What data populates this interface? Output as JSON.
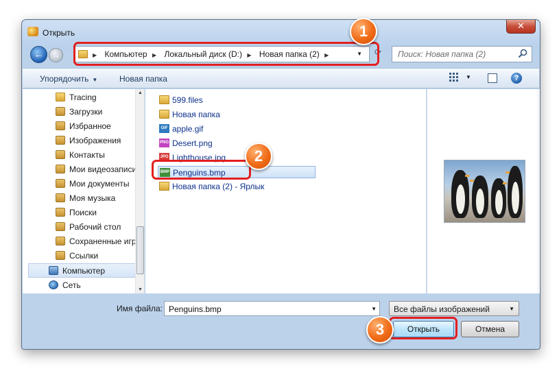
{
  "window": {
    "title": "Открыть",
    "close_label": "✕"
  },
  "address": {
    "crumbs": [
      "Компьютер",
      "Локальный диск (D:)",
      "Новая папка (2)"
    ]
  },
  "search": {
    "placeholder": "Поиск: Новая папка (2)"
  },
  "toolbar": {
    "organize": "Упорядочить",
    "new_folder": "Новая папка"
  },
  "nav": {
    "items": [
      {
        "label": "Tracing",
        "icon": "folder-icon"
      },
      {
        "label": "Загрузки",
        "icon": "downloads-icon"
      },
      {
        "label": "Избранное",
        "icon": "favorites-icon"
      },
      {
        "label": "Изображения",
        "icon": "pictures-icon"
      },
      {
        "label": "Контакты",
        "icon": "contacts-icon"
      },
      {
        "label": "Мои видеозаписи",
        "icon": "videos-icon"
      },
      {
        "label": "Мои документы",
        "icon": "documents-icon"
      },
      {
        "label": "Моя музыка",
        "icon": "music-icon"
      },
      {
        "label": "Поиски",
        "icon": "searches-icon"
      },
      {
        "label": "Рабочий стол",
        "icon": "desktop-icon"
      },
      {
        "label": "Сохраненные игр",
        "icon": "saved-games-icon"
      },
      {
        "label": "Ссылки",
        "icon": "links-icon"
      },
      {
        "label": "Компьютер",
        "icon": "computer-icon"
      },
      {
        "label": "Сеть",
        "icon": "network-icon"
      }
    ]
  },
  "files": {
    "items": [
      {
        "name": "599.files",
        "icon": "folder-icon"
      },
      {
        "name": "Новая папка",
        "icon": "folder-icon"
      },
      {
        "name": "apple.gif",
        "icon": "gif-file-icon"
      },
      {
        "name": "Desert.png",
        "icon": "png-file-icon"
      },
      {
        "name": "Lighthouse.jpg",
        "icon": "jpg-file-icon"
      },
      {
        "name": "Penguins.bmp",
        "icon": "bmp-file-icon"
      },
      {
        "name": "Новая папка (2) - Ярлык",
        "icon": "shortcut-icon"
      }
    ],
    "selected": "Penguins.bmp"
  },
  "bottom": {
    "filename_label": "Имя файла:",
    "filename_value": "Penguins.bmp",
    "filter": "Все файлы изображений",
    "open_label": "Открыть",
    "cancel_label": "Отмена"
  },
  "annotations": {
    "step1": "1",
    "step2": "2",
    "step3": "3"
  },
  "colors": {
    "highlight": "#e31f1f",
    "badge": "#f06c17",
    "window_frame": "#b9d1ec"
  }
}
